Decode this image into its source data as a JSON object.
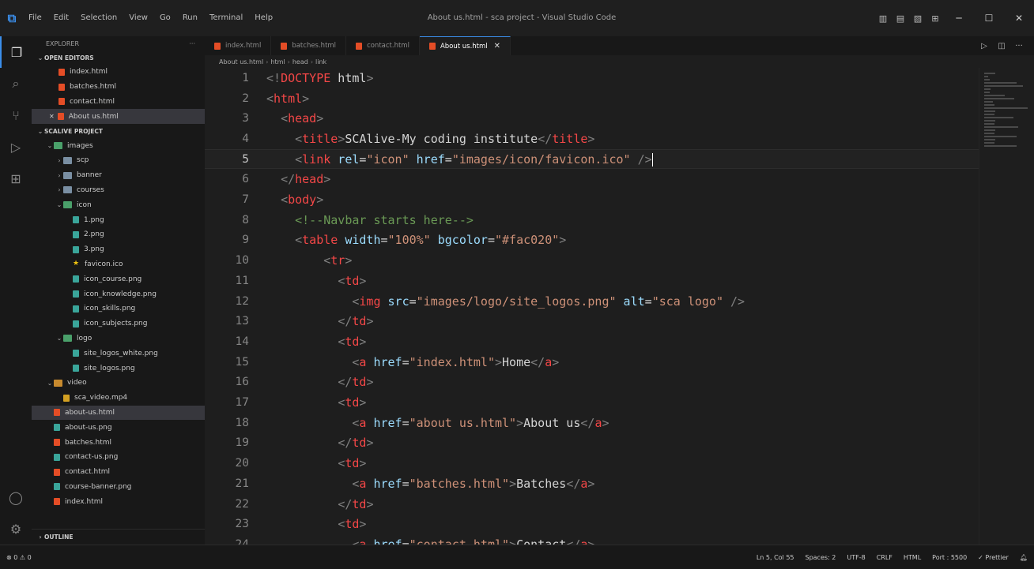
{
  "window": {
    "app_logo": "vscode-logo-icon",
    "title": "About us.html - sca project - Visual Studio Code",
    "menu": [
      "File",
      "Edit",
      "Selection",
      "View",
      "Go",
      "Run",
      "Terminal",
      "Help"
    ]
  },
  "activity_bar": {
    "icons": [
      "explorer-icon",
      "search-icon",
      "source-control-icon",
      "run-debug-icon",
      "extensions-icon"
    ],
    "bottom_icons": [
      "accounts-icon",
      "manage-gear-icon"
    ]
  },
  "sidebar": {
    "header": "EXPLORER",
    "more": "···",
    "open_editors_label": "OPEN EDITORS",
    "open_editors": [
      "index.html",
      "batches.html",
      "contact.html",
      "About us.html"
    ],
    "project_label": "SCALIVE PROJECT",
    "tree": [
      {
        "name": "images",
        "type": "folder-img",
        "open": true,
        "depth": 1
      },
      {
        "name": "scp",
        "type": "folder",
        "open": false,
        "depth": 2
      },
      {
        "name": "banner",
        "type": "folder",
        "open": false,
        "depth": 2
      },
      {
        "name": "courses",
        "type": "folder",
        "open": false,
        "depth": 2
      },
      {
        "name": "icon",
        "type": "folder-img",
        "open": true,
        "depth": 2
      },
      {
        "name": "1.png",
        "type": "png",
        "depth": 3
      },
      {
        "name": "2.png",
        "type": "png",
        "depth": 3
      },
      {
        "name": "3.png",
        "type": "png",
        "depth": 3
      },
      {
        "name": "favicon.ico",
        "type": "star",
        "depth": 3
      },
      {
        "name": "icon_course.png",
        "type": "png",
        "depth": 3
      },
      {
        "name": "icon_knowledge.png",
        "type": "png",
        "depth": 3
      },
      {
        "name": "icon_skills.png",
        "type": "png",
        "depth": 3
      },
      {
        "name": "icon_subjects.png",
        "type": "png",
        "depth": 3
      },
      {
        "name": "logo",
        "type": "folder-img",
        "open": true,
        "depth": 2
      },
      {
        "name": "site_logos_white.png",
        "type": "png",
        "depth": 3
      },
      {
        "name": "site_logos.png",
        "type": "png",
        "depth": 3
      },
      {
        "name": "video",
        "type": "folder-vid",
        "open": true,
        "depth": 1
      },
      {
        "name": "sca_video.mp4",
        "type": "mp4",
        "depth": 2
      },
      {
        "name": "about-us.html",
        "type": "html",
        "depth": 1,
        "selected": true
      },
      {
        "name": "about-us.png",
        "type": "png",
        "depth": 1
      },
      {
        "name": "batches.html",
        "type": "html",
        "depth": 1
      },
      {
        "name": "contact-us.png",
        "type": "png",
        "depth": 1
      },
      {
        "name": "contact.html",
        "type": "html",
        "depth": 1
      },
      {
        "name": "course-banner.png",
        "type": "png",
        "depth": 1
      },
      {
        "name": "index.html",
        "type": "html",
        "depth": 1
      }
    ],
    "outline_label": "OUTLINE"
  },
  "tabs": [
    {
      "label": "index.html",
      "active": false
    },
    {
      "label": "batches.html",
      "active": false
    },
    {
      "label": "contact.html",
      "active": false
    },
    {
      "label": "About us.html",
      "active": true
    }
  ],
  "breadcrumbs": [
    "About us.html",
    "html",
    "head",
    "link"
  ],
  "editor": {
    "current_line": 5,
    "lines": [
      {
        "n": "1",
        "tokens": [
          [
            "p",
            "<!"
          ],
          [
            "t",
            "DOCTYPE"
          ],
          [
            "x",
            " html"
          ],
          [
            "p",
            ">"
          ]
        ]
      },
      {
        "n": "2",
        "tokens": [
          [
            "p",
            "<"
          ],
          [
            "t",
            "html"
          ],
          [
            "p",
            ">"
          ]
        ]
      },
      {
        "n": "3",
        "tokens": [
          [
            "x",
            "  "
          ],
          [
            "p",
            "<"
          ],
          [
            "t",
            "head"
          ],
          [
            "p",
            ">"
          ]
        ]
      },
      {
        "n": "4",
        "tokens": [
          [
            "x",
            "    "
          ],
          [
            "p",
            "<"
          ],
          [
            "t",
            "title"
          ],
          [
            "p",
            ">"
          ],
          [
            "x",
            "SCAlive-My coding institute"
          ],
          [
            "p",
            "</"
          ],
          [
            "t",
            "title"
          ],
          [
            "p",
            ">"
          ]
        ]
      },
      {
        "n": "5",
        "tokens": [
          [
            "x",
            "    "
          ],
          [
            "p",
            "<"
          ],
          [
            "t",
            "link"
          ],
          [
            "a",
            " rel"
          ],
          [
            "x",
            "="
          ],
          [
            "s",
            "\"icon\""
          ],
          [
            "a",
            " href"
          ],
          [
            "x",
            "="
          ],
          [
            "s",
            "\"images/icon/favicon.ico\""
          ],
          [
            "x",
            " "
          ],
          [
            "p",
            "/>"
          ]
        ]
      },
      {
        "n": "6",
        "tokens": [
          [
            "x",
            "  "
          ],
          [
            "p",
            "</"
          ],
          [
            "t",
            "head"
          ],
          [
            "p",
            ">"
          ]
        ]
      },
      {
        "n": "7",
        "tokens": [
          [
            "x",
            "  "
          ],
          [
            "p",
            "<"
          ],
          [
            "t",
            "body"
          ],
          [
            "p",
            ">"
          ]
        ]
      },
      {
        "n": "8",
        "tokens": [
          [
            "x",
            "    "
          ],
          [
            "c",
            "<!--Navbar starts here-->"
          ]
        ]
      },
      {
        "n": "9",
        "tokens": [
          [
            "x",
            "    "
          ],
          [
            "p",
            "<"
          ],
          [
            "t",
            "table"
          ],
          [
            "a",
            " width"
          ],
          [
            "x",
            "="
          ],
          [
            "s",
            "\"100%\""
          ],
          [
            "a",
            " bgcolor"
          ],
          [
            "x",
            "="
          ],
          [
            "s",
            "\"#fac020\""
          ],
          [
            "p",
            ">"
          ]
        ]
      },
      {
        "n": "10",
        "tokens": [
          [
            "x",
            "        "
          ],
          [
            "p",
            "<"
          ],
          [
            "t",
            "tr"
          ],
          [
            "p",
            ">"
          ]
        ]
      },
      {
        "n": "11",
        "tokens": [
          [
            "x",
            "          "
          ],
          [
            "p",
            "<"
          ],
          [
            "t",
            "td"
          ],
          [
            "p",
            ">"
          ]
        ]
      },
      {
        "n": "12",
        "tokens": [
          [
            "x",
            "            "
          ],
          [
            "p",
            "<"
          ],
          [
            "t",
            "img"
          ],
          [
            "a",
            " src"
          ],
          [
            "x",
            "="
          ],
          [
            "s",
            "\"images/logo/site_logos.png\""
          ],
          [
            "a",
            " alt"
          ],
          [
            "x",
            "="
          ],
          [
            "s",
            "\"sca logo\""
          ],
          [
            "x",
            " "
          ],
          [
            "p",
            "/>"
          ]
        ]
      },
      {
        "n": "13",
        "tokens": [
          [
            "x",
            "          "
          ],
          [
            "p",
            "</"
          ],
          [
            "t",
            "td"
          ],
          [
            "p",
            ">"
          ]
        ]
      },
      {
        "n": "14",
        "tokens": [
          [
            "x",
            "          "
          ],
          [
            "p",
            "<"
          ],
          [
            "t",
            "td"
          ],
          [
            "p",
            ">"
          ]
        ]
      },
      {
        "n": "15",
        "tokens": [
          [
            "x",
            "            "
          ],
          [
            "p",
            "<"
          ],
          [
            "t",
            "a"
          ],
          [
            "a",
            " href"
          ],
          [
            "x",
            "="
          ],
          [
            "s",
            "\"index.html\""
          ],
          [
            "p",
            ">"
          ],
          [
            "x",
            "Home"
          ],
          [
            "p",
            "</"
          ],
          [
            "t",
            "a"
          ],
          [
            "p",
            ">"
          ]
        ]
      },
      {
        "n": "16",
        "tokens": [
          [
            "x",
            "          "
          ],
          [
            "p",
            "</"
          ],
          [
            "t",
            "td"
          ],
          [
            "p",
            ">"
          ]
        ]
      },
      {
        "n": "17",
        "tokens": [
          [
            "x",
            "          "
          ],
          [
            "p",
            "<"
          ],
          [
            "t",
            "td"
          ],
          [
            "p",
            ">"
          ]
        ]
      },
      {
        "n": "18",
        "tokens": [
          [
            "x",
            "            "
          ],
          [
            "p",
            "<"
          ],
          [
            "t",
            "a"
          ],
          [
            "a",
            " href"
          ],
          [
            "x",
            "="
          ],
          [
            "s",
            "\"about us.html\""
          ],
          [
            "p",
            ">"
          ],
          [
            "x",
            "About us"
          ],
          [
            "p",
            "</"
          ],
          [
            "t",
            "a"
          ],
          [
            "p",
            ">"
          ]
        ]
      },
      {
        "n": "19",
        "tokens": [
          [
            "x",
            "          "
          ],
          [
            "p",
            "</"
          ],
          [
            "t",
            "td"
          ],
          [
            "p",
            ">"
          ]
        ]
      },
      {
        "n": "20",
        "tokens": [
          [
            "x",
            "          "
          ],
          [
            "p",
            "<"
          ],
          [
            "t",
            "td"
          ],
          [
            "p",
            ">"
          ]
        ]
      },
      {
        "n": "21",
        "tokens": [
          [
            "x",
            "            "
          ],
          [
            "p",
            "<"
          ],
          [
            "t",
            "a"
          ],
          [
            "a",
            " href"
          ],
          [
            "x",
            "="
          ],
          [
            "s",
            "\"batches.html\""
          ],
          [
            "p",
            ">"
          ],
          [
            "x",
            "Batches"
          ],
          [
            "p",
            "</"
          ],
          [
            "t",
            "a"
          ],
          [
            "p",
            ">"
          ]
        ]
      },
      {
        "n": "22",
        "tokens": [
          [
            "x",
            "          "
          ],
          [
            "p",
            "</"
          ],
          [
            "t",
            "td"
          ],
          [
            "p",
            ">"
          ]
        ]
      },
      {
        "n": "23",
        "tokens": [
          [
            "x",
            "          "
          ],
          [
            "p",
            "<"
          ],
          [
            "t",
            "td"
          ],
          [
            "p",
            ">"
          ]
        ]
      },
      {
        "n": "24",
        "tokens": [
          [
            "x",
            "            "
          ],
          [
            "p",
            "<"
          ],
          [
            "t",
            "a"
          ],
          [
            "a",
            " href"
          ],
          [
            "x",
            "="
          ],
          [
            "s",
            "\"contact.html\""
          ],
          [
            "p",
            ">"
          ],
          [
            "x",
            "Contact"
          ],
          [
            "p",
            "</"
          ],
          [
            "t",
            "a"
          ],
          [
            "p",
            ">"
          ]
        ]
      }
    ]
  },
  "status_bar": {
    "left": "⊗ 0 ⚠ 0",
    "cursor_position": "Ln 5, Col 55",
    "spaces": "Spaces: 2",
    "encoding": "UTF-8",
    "eol": "CRLF",
    "language": "HTML",
    "port": "Port : 5500",
    "prettier": "✓ Prettier"
  },
  "colors": {
    "accent": "#3b8eea",
    "tag": "#569cd6",
    "string": "#ce9178",
    "attribute": "#9cdcfe",
    "comment": "#6a9955"
  }
}
